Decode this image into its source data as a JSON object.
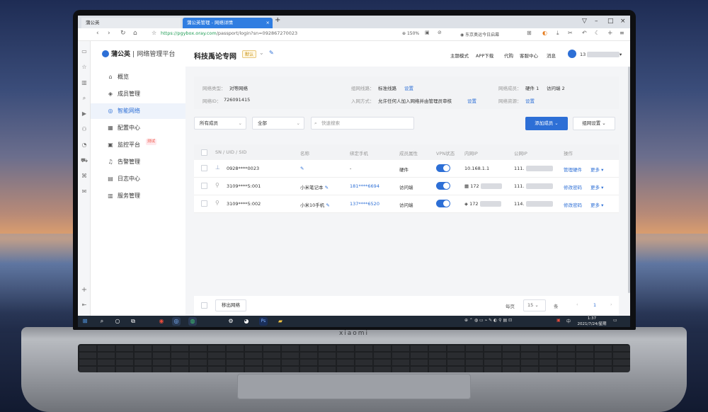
{
  "browser": {
    "tabs": [
      {
        "label": "蒲公英"
      },
      {
        "label": "蒲公英管理 - 网络详情"
      }
    ],
    "new_tab": "+",
    "url_scheme": "https://",
    "url_host": "pgybox.oray.com",
    "url_path": "/passport/login?sn=092867270023",
    "zoom": "150%",
    "news": "东京奥运今日启幕"
  },
  "app": {
    "logo_brand": "蒲公英",
    "logo_sep": "|",
    "logo_sub": "网络管理平台",
    "nav": [
      {
        "label": "概览",
        "icon": "⌂"
      },
      {
        "label": "成员管理",
        "icon": "◈"
      },
      {
        "label": "智能网络",
        "icon": "◎"
      },
      {
        "label": "配置中心",
        "icon": "▦"
      },
      {
        "label": "监控平台",
        "icon": "▣",
        "badge": "测试"
      },
      {
        "label": "告警管理",
        "icon": "♫"
      },
      {
        "label": "日志中心",
        "icon": "▤"
      },
      {
        "label": "服务管理",
        "icon": "▥"
      }
    ],
    "header": {
      "network_name": "科技禹论专网",
      "network_tag": "默认",
      "links": [
        "主题模式",
        "APP下载",
        "代购",
        "客服中心",
        "消息"
      ],
      "user_prefix": "13"
    },
    "info": {
      "type_label": "网络类型：",
      "type_value": "对等网络",
      "line_label": "组网线路：",
      "line_value": "标准线路",
      "line_action": "设置",
      "members_label": "网络成员：",
      "members_hw": "硬件 1",
      "members_client": "访问端 2",
      "id_label": "网络ID：",
      "id_value": "726091415",
      "join_label": "入网方式：",
      "join_value": "允许任何人加入网络并由管理员审核",
      "join_action": "设置",
      "resource_label": "网络资源：",
      "resource_action": "设置"
    },
    "filters": {
      "members_select": "所有成员",
      "status_select": "全部",
      "search_placeholder": "快速搜索",
      "add_member": "添加成员",
      "network_settings": "组网设置"
    },
    "table": {
      "headers": [
        "SN / UID / SID",
        "名称",
        "绑定手机",
        "成员属性",
        "VPN状态",
        "内网IP",
        "公网IP",
        "操作"
      ],
      "rows": [
        {
          "sn": "0928****0023",
          "name": "",
          "phone": "-",
          "attr": "硬件",
          "vpn": true,
          "lan_ip": "10.168.1.1",
          "wan_ip": "111.",
          "action": "管理硬件",
          "more": "更多"
        },
        {
          "sn": "3109****5:001",
          "name": "小米笔记本",
          "phone": "181****6694",
          "attr": "访问端",
          "vpn": true,
          "lan_ip": "172",
          "wan_ip": "111.",
          "action": "修改密码",
          "more": "更多"
        },
        {
          "sn": "3109****5:002",
          "name": "小米10手机",
          "phone": "137****6520",
          "attr": "访问端",
          "vpn": true,
          "lan_ip": "172",
          "wan_ip": "114.",
          "action": "修改密码",
          "more": "更多"
        }
      ]
    },
    "footer": {
      "leave": "移出网络",
      "per_page_label": "每页",
      "per_page": "15",
      "unit": "条",
      "page": "1"
    }
  },
  "laptop_brand": "xiaomi",
  "taskbar": {
    "time": "1:37",
    "date": "2021/7/24/星期六",
    "ime": "中"
  },
  "colors": {
    "primary": "#2d6fd6",
    "toggle": "#2d6fd6"
  }
}
